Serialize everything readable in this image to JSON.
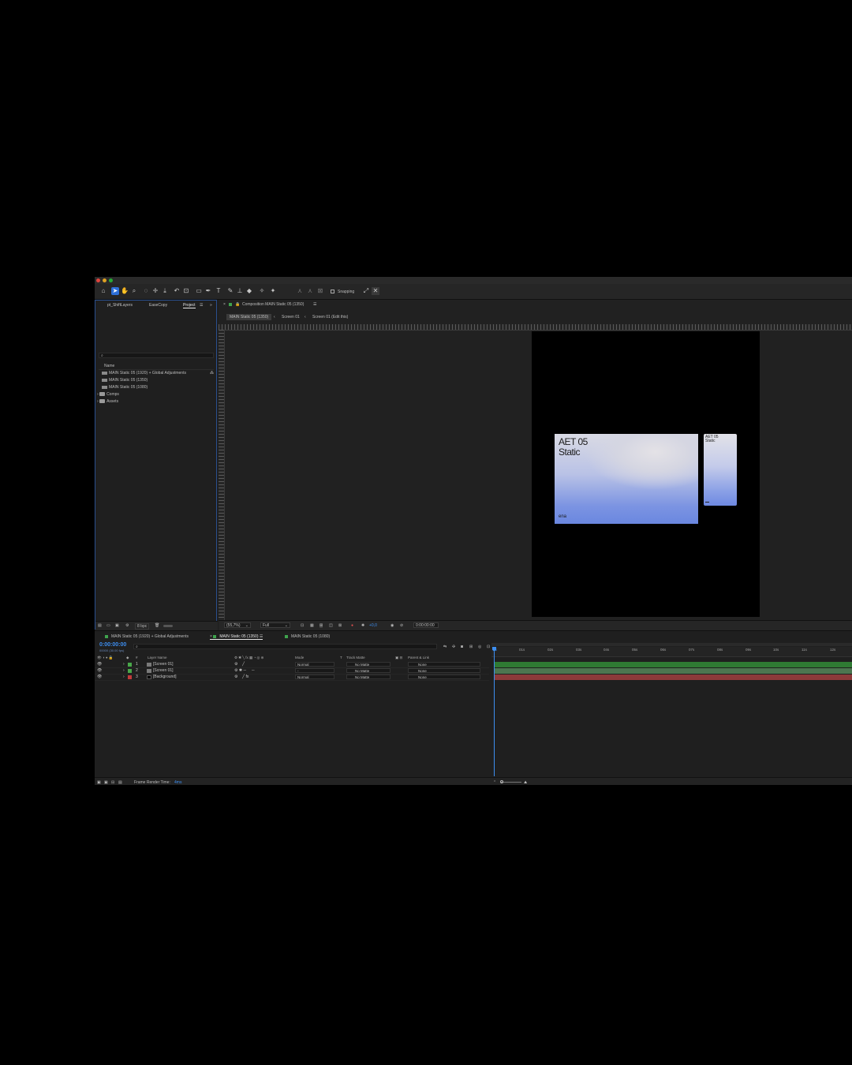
{
  "toolbar": {
    "snapping_label": "Snapping"
  },
  "project_panel": {
    "tabs": [
      "pt_ShiftLayers",
      "EaseCopy",
      "Project"
    ],
    "column_name": "Name",
    "items": [
      {
        "label": "MAIN Static 05 (1920) + Global Adjustments",
        "kind": "comp"
      },
      {
        "label": "MAIN Static 05 (1350)",
        "kind": "comp"
      },
      {
        "label": "MAIN Static 05 (1080)",
        "kind": "comp"
      },
      {
        "label": "Comps",
        "kind": "folder"
      },
      {
        "label": "Assets",
        "kind": "folder"
      }
    ],
    "bpc": "8 bpc"
  },
  "viewer": {
    "panel_title": "Composition MAIN Static 05 (1350)",
    "breadcrumbs": [
      "MAIN Static 05 (1350)",
      "Screen 01",
      "Screen 01 (Edit this)"
    ],
    "card_title_line1": "AET 05",
    "card_title_line2": "Static",
    "card_footer": "ena",
    "small_card_title_line1": "AET 05",
    "small_card_title_line2": "Static",
    "zoom": "(55,7%)",
    "resolution": "Full",
    "exposure": "+0,0",
    "timecode": "0:00:00:00"
  },
  "timeline": {
    "tabs": [
      "MAIN Static 05 (1920) + Global Adjustments",
      "MAIN Static 05 (1350)",
      "MAIN Static 05 (1080)"
    ],
    "current_time": "0:00:00:00",
    "fps": "00000 (30.00 fps)",
    "columns": {
      "num": "#",
      "layer_name": "Layer Name",
      "mode": "Mode",
      "t": "T",
      "track_matte": "Track Matte",
      "parent": "Parent & Link"
    },
    "layers": [
      {
        "num": "1",
        "name": "[Screen 01]",
        "mode": "Normal",
        "matte": "No Matte",
        "parent": "None",
        "label_color": "#49a84a",
        "bar_color": "#2f7a33"
      },
      {
        "num": "2",
        "name": "[Screen 01]",
        "mode": "-",
        "matte": "No Matte",
        "parent": "None",
        "label_color": "#49a84a",
        "bar_color": "#4c7650"
      },
      {
        "num": "3",
        "name": "[Background]",
        "mode": "Normal",
        "matte": "No Matte",
        "parent": "None",
        "label_color": "#c23b3b",
        "bar_color": "#8c3a3a"
      }
    ],
    "ruler_ticks": [
      "0s",
      "01s",
      "02s",
      "03s",
      "04s",
      "05s",
      "06s",
      "07s",
      "08s",
      "09s",
      "10s",
      "11s",
      "12s"
    ],
    "render_time_label": "Frame Render Time:",
    "render_time_value": "4ms"
  },
  "colors": {
    "accent": "#2d6fd8",
    "panel_bg": "#1f1f1f",
    "timecode": "#3d8ef0"
  }
}
